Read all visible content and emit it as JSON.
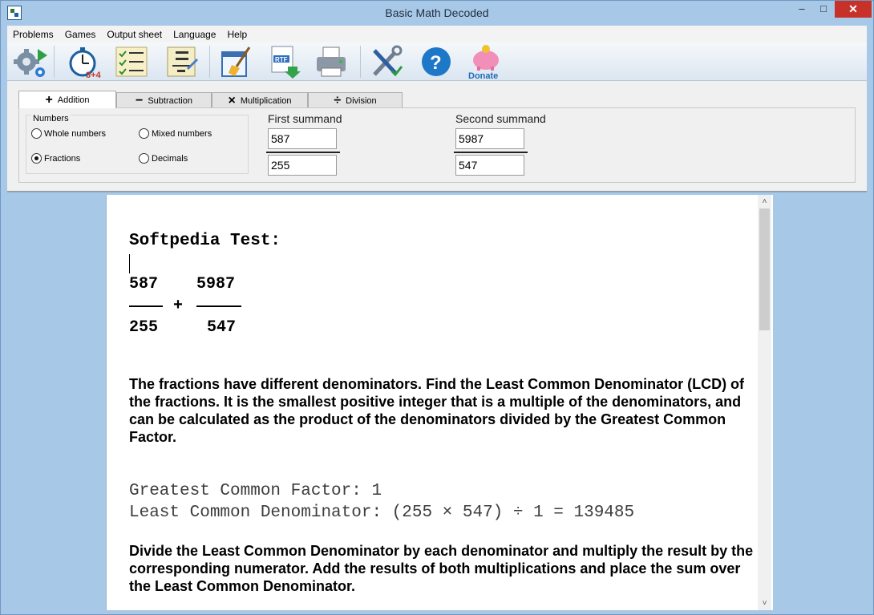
{
  "window": {
    "title": "Basic Math Decoded"
  },
  "menu": [
    "Problems",
    "Games",
    "Output sheet",
    "Language",
    "Help"
  ],
  "toolbar": {
    "icons": [
      "settings-icon",
      "timer-icon",
      "worksheet-icon",
      "addition-sheet-icon",
      "clear-icon",
      "rtf-export-icon",
      "print-icon",
      "tools-icon",
      "help-icon",
      "donate-icon"
    ],
    "donate_label": "Donate",
    "timer_label": "3+4",
    "rtf_label": "RTF"
  },
  "tabs": [
    {
      "symbol": "+",
      "label": "Addition",
      "active": true
    },
    {
      "symbol": "−",
      "label": "Subtraction",
      "active": false
    },
    {
      "symbol": "×",
      "label": "Multiplication",
      "active": false
    },
    {
      "symbol": "÷",
      "label": "Division",
      "active": false
    }
  ],
  "numbers_group": {
    "title": "Numbers",
    "options": [
      {
        "label": "Whole numbers",
        "selected": false
      },
      {
        "label": "Mixed numbers",
        "selected": false
      },
      {
        "label": "Fractions",
        "selected": true
      },
      {
        "label": "Decimals",
        "selected": false
      }
    ]
  },
  "first_summand": {
    "label": "First summand",
    "numerator": "587",
    "denominator": "255"
  },
  "second_summand": {
    "label": "Second summand",
    "numerator": "5987",
    "denominator": "547"
  },
  "document": {
    "title": "Softpedia Test:",
    "problem": {
      "num1": "587",
      "den1": "255",
      "operator": "+",
      "num2": "5987",
      "den2": "547"
    },
    "paragraph1": "The fractions have different denominators. Find the Least Common Denominator (LCD) of the fractions. It is the smallest positive integer that is a multiple of the denominators, and can be calculated as the product of the denominators divided by the Greatest Common Factor.",
    "gcf_line": "Greatest Common Factor: 1",
    "lcd_line": "Least Common Denominator: (255 × 547) ÷ 1 = 139485",
    "paragraph2": "Divide the Least Common Denominator by each denominator and multiply the result by the corresponding numerator. Add the results of both multiplications and place the sum over the Least Common Denominator."
  },
  "colors": {
    "frame": "#a8c8e8",
    "close_button": "#c7312a",
    "help_blue": "#1e78c8",
    "donate_pink": "#e85a9a"
  }
}
